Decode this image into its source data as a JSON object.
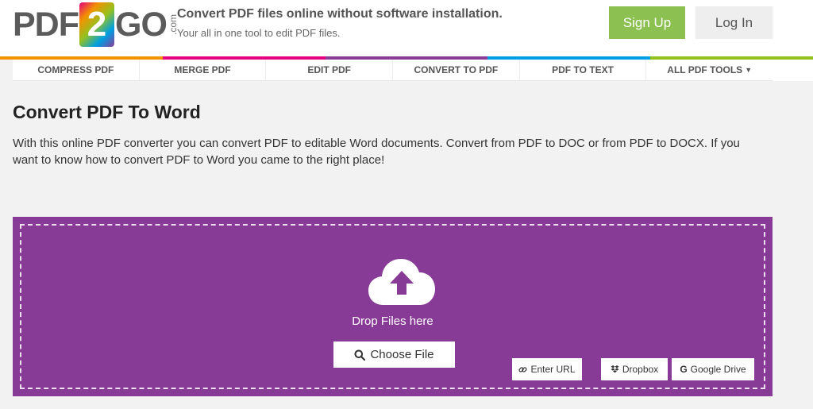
{
  "header": {
    "logo": {
      "pre": "PDF",
      "mid": "2",
      "post": "GO",
      "suffix": ".com"
    },
    "tagline": "Convert PDF files online without software installation.",
    "subtagline": "Your all in one tool to edit PDF files.",
    "signup_label": "Sign Up",
    "login_label": "Log In"
  },
  "color_strip": [
    "#f39200",
    "#e6007e",
    "#8b3c97",
    "#009fe3",
    "#95c11f"
  ],
  "nav": {
    "items": [
      {
        "label": "COMPRESS PDF"
      },
      {
        "label": "MERGE PDF"
      },
      {
        "label": "EDIT PDF"
      },
      {
        "label": "CONVERT TO PDF"
      },
      {
        "label": "PDF TO TEXT"
      },
      {
        "label": "ALL PDF TOOLS"
      }
    ]
  },
  "main": {
    "title": "Convert PDF To Word",
    "description": "With this online PDF converter you can convert PDF to editable Word documents. Convert from PDF to DOC or from PDF to DOCX. If you want to know how to convert PDF to Word you came to the right place!"
  },
  "upload": {
    "accent": "#883b96",
    "drop_text": "Drop Files here",
    "choose_label": "Choose File",
    "sources": [
      {
        "label": "Enter URL",
        "icon": "link-icon"
      },
      {
        "label": "Dropbox",
        "icon": "dropbox-icon"
      },
      {
        "label": "Google Drive",
        "icon": "google-icon"
      }
    ]
  }
}
